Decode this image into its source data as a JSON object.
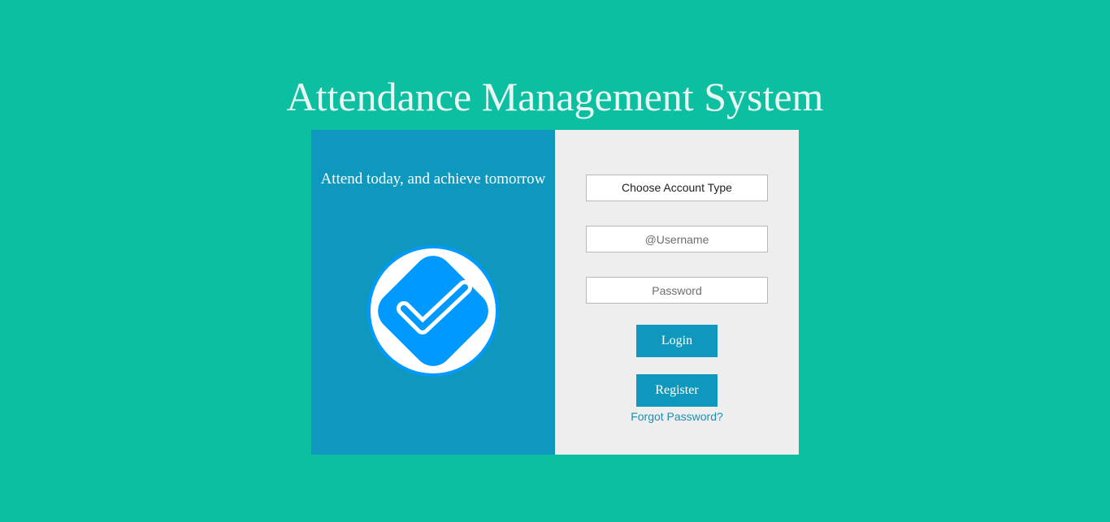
{
  "header": {
    "title": "Attendance Management System"
  },
  "left_panel": {
    "tagline": "Attend today, and achieve tomorrow",
    "logo_icon": "checkmark-badge-icon"
  },
  "login_form": {
    "account_type": {
      "selected": "Choose Account Type"
    },
    "username": {
      "value": "",
      "placeholder": "@Username"
    },
    "password": {
      "value": "",
      "placeholder": "Password"
    },
    "login_label": "Login",
    "register_label": "Register",
    "forgot_password_label": "Forgot Password?"
  },
  "colors": {
    "background": "#0cbfa0",
    "left_panel": "#0e98bd",
    "right_panel": "#eeeeee",
    "button": "#0e98bd",
    "logo_blue": "#0099ff",
    "link": "#1a8fb5"
  }
}
